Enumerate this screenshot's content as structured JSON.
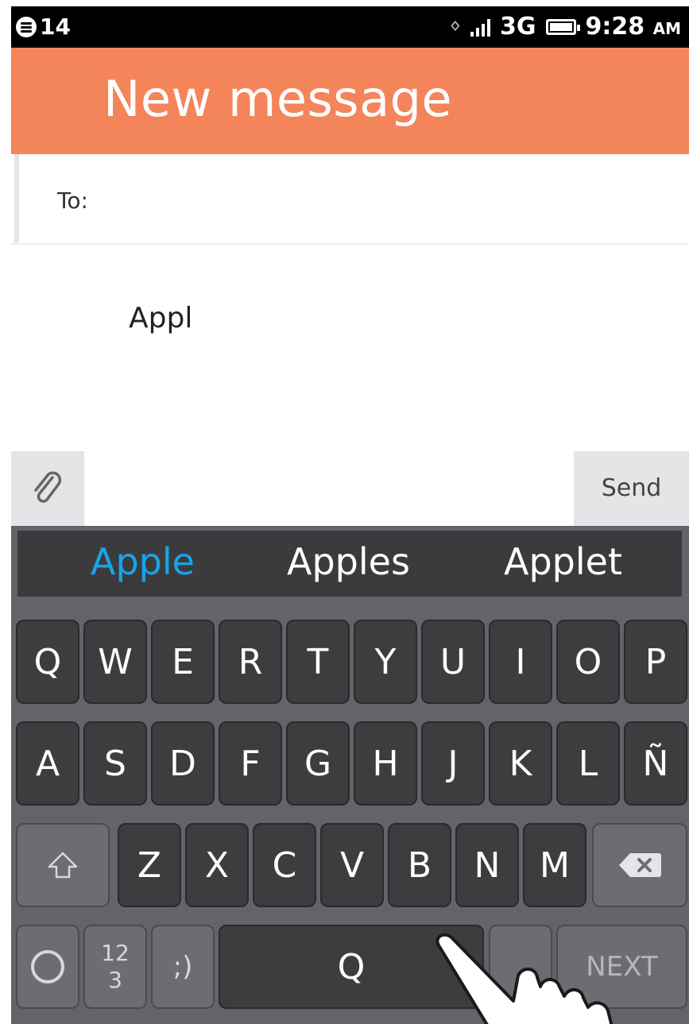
{
  "status_bar": {
    "notification_count": "14",
    "network": "3G",
    "time": "9:28",
    "ampm": "AM"
  },
  "header": {
    "title": "New message"
  },
  "compose": {
    "to_label": "To:",
    "message_text": "Appl",
    "send_label": "Send"
  },
  "keyboard": {
    "suggestions": [
      "Apple",
      "Apples",
      "Applet"
    ],
    "row1": [
      "Q",
      "W",
      "E",
      "R",
      "T",
      "Y",
      "U",
      "I",
      "O",
      "P"
    ],
    "row2": [
      "A",
      "S",
      "D",
      "F",
      "G",
      "H",
      "J",
      "K",
      "L",
      "Ñ"
    ],
    "row3": [
      "Z",
      "X",
      "C",
      "V",
      "B",
      "N",
      "M"
    ],
    "numbers_key": [
      "12",
      "3"
    ],
    "emoji_key": ";)",
    "space_key": "Q",
    "next_key": "NEXT"
  },
  "colors": {
    "header_bg": "#f4845a",
    "keyboard_bg": "#62646a",
    "suggestion_accent": "#1aa3e8"
  }
}
